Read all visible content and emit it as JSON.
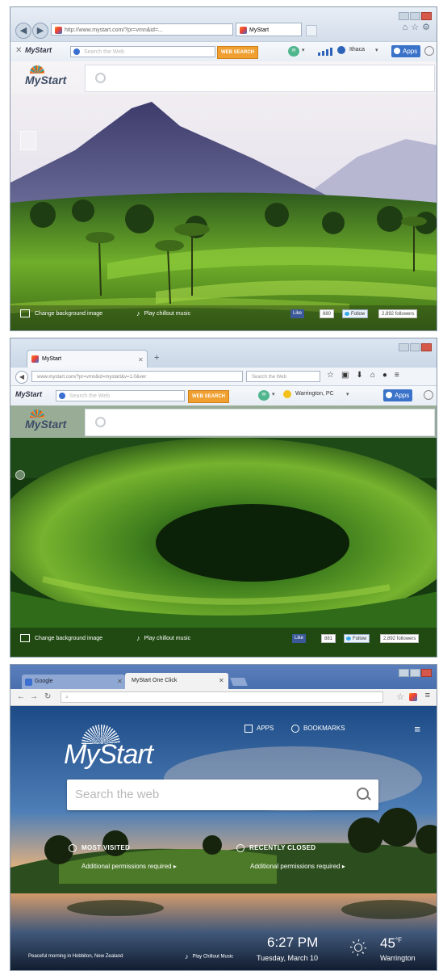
{
  "ie": {
    "address": "http://www.mystart.com/?pr=vmn&id=...",
    "address_domain": "mystart.com",
    "tab_title": "MyStart",
    "toolbar": {
      "logo": "MyStart",
      "search_placeholder": "Search the Web",
      "web_search": "WEB SEARCH",
      "location": "Ithaca",
      "apps": "Apps"
    },
    "footer": {
      "change_bg": "Change background image",
      "music": "Play chillout music",
      "like": "Like",
      "like_count": "880",
      "follow": "Follow",
      "followers": "2,892 followers"
    }
  },
  "ff": {
    "tab_title": "MyStart",
    "address": "www.mystart.com/?pr=vmn&id=mystart&v=1.0&ver",
    "address_domain": "mystart.com",
    "search_placeholder": "Search the Web",
    "toolbar": {
      "logo": "MyStart",
      "search_placeholder": "Search the Web",
      "web_search": "WEB SEARCH",
      "location": "Warrington, PC",
      "apps": "Apps"
    },
    "footer": {
      "change_bg": "Change background image",
      "music": "Play chillout music",
      "like": "Like",
      "like_count": "881",
      "follow": "Follow",
      "followers": "2,892 followers"
    }
  },
  "chrome": {
    "tab1": "Google",
    "tab2": "MyStart One Click",
    "logo": "MyStart",
    "apps": "APPS",
    "bookmarks": "BOOKMARKS",
    "search_placeholder": "Search the web",
    "most_visited": "MOST VISITED",
    "recently_closed": "RECENTLY CLOSED",
    "permissions_left": "Additional permissions required ▸",
    "permissions_right": "Additional permissions required ▸",
    "caption": "Peaceful morning in Hobbiton, New Zealand",
    "music": "Play Chillout Music",
    "time": "6:27 PM",
    "date": "Tuesday, March 10",
    "temperature": "45",
    "unit": "°F",
    "city": "Warrington"
  },
  "colors": {
    "apps_button": "#3a72c9",
    "web_search": "#f0a030",
    "ie_frame": "#d3dde9",
    "chrome_frame": "#4a6fae"
  }
}
